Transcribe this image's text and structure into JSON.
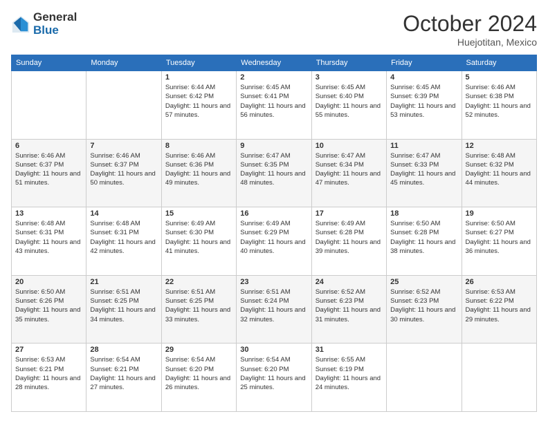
{
  "logo": {
    "general": "General",
    "blue": "Blue"
  },
  "header": {
    "month": "October 2024",
    "location": "Huejotitan, Mexico"
  },
  "weekdays": [
    "Sunday",
    "Monday",
    "Tuesday",
    "Wednesday",
    "Thursday",
    "Friday",
    "Saturday"
  ],
  "weeks": [
    [
      {
        "day": null,
        "info": null
      },
      {
        "day": null,
        "info": null
      },
      {
        "day": "1",
        "sunrise": "6:44 AM",
        "sunset": "6:42 PM",
        "daylight": "11 hours and 57 minutes."
      },
      {
        "day": "2",
        "sunrise": "6:45 AM",
        "sunset": "6:41 PM",
        "daylight": "11 hours and 56 minutes."
      },
      {
        "day": "3",
        "sunrise": "6:45 AM",
        "sunset": "6:40 PM",
        "daylight": "11 hours and 55 minutes."
      },
      {
        "day": "4",
        "sunrise": "6:45 AM",
        "sunset": "6:39 PM",
        "daylight": "11 hours and 53 minutes."
      },
      {
        "day": "5",
        "sunrise": "6:46 AM",
        "sunset": "6:38 PM",
        "daylight": "11 hours and 52 minutes."
      }
    ],
    [
      {
        "day": "6",
        "sunrise": "6:46 AM",
        "sunset": "6:37 PM",
        "daylight": "11 hours and 51 minutes."
      },
      {
        "day": "7",
        "sunrise": "6:46 AM",
        "sunset": "6:37 PM",
        "daylight": "11 hours and 50 minutes."
      },
      {
        "day": "8",
        "sunrise": "6:46 AM",
        "sunset": "6:36 PM",
        "daylight": "11 hours and 49 minutes."
      },
      {
        "day": "9",
        "sunrise": "6:47 AM",
        "sunset": "6:35 PM",
        "daylight": "11 hours and 48 minutes."
      },
      {
        "day": "10",
        "sunrise": "6:47 AM",
        "sunset": "6:34 PM",
        "daylight": "11 hours and 47 minutes."
      },
      {
        "day": "11",
        "sunrise": "6:47 AM",
        "sunset": "6:33 PM",
        "daylight": "11 hours and 45 minutes."
      },
      {
        "day": "12",
        "sunrise": "6:48 AM",
        "sunset": "6:32 PM",
        "daylight": "11 hours and 44 minutes."
      }
    ],
    [
      {
        "day": "13",
        "sunrise": "6:48 AM",
        "sunset": "6:31 PM",
        "daylight": "11 hours and 43 minutes."
      },
      {
        "day": "14",
        "sunrise": "6:48 AM",
        "sunset": "6:31 PM",
        "daylight": "11 hours and 42 minutes."
      },
      {
        "day": "15",
        "sunrise": "6:49 AM",
        "sunset": "6:30 PM",
        "daylight": "11 hours and 41 minutes."
      },
      {
        "day": "16",
        "sunrise": "6:49 AM",
        "sunset": "6:29 PM",
        "daylight": "11 hours and 40 minutes."
      },
      {
        "day": "17",
        "sunrise": "6:49 AM",
        "sunset": "6:28 PM",
        "daylight": "11 hours and 39 minutes."
      },
      {
        "day": "18",
        "sunrise": "6:50 AM",
        "sunset": "6:28 PM",
        "daylight": "11 hours and 38 minutes."
      },
      {
        "day": "19",
        "sunrise": "6:50 AM",
        "sunset": "6:27 PM",
        "daylight": "11 hours and 36 minutes."
      }
    ],
    [
      {
        "day": "20",
        "sunrise": "6:50 AM",
        "sunset": "6:26 PM",
        "daylight": "11 hours and 35 minutes."
      },
      {
        "day": "21",
        "sunrise": "6:51 AM",
        "sunset": "6:25 PM",
        "daylight": "11 hours and 34 minutes."
      },
      {
        "day": "22",
        "sunrise": "6:51 AM",
        "sunset": "6:25 PM",
        "daylight": "11 hours and 33 minutes."
      },
      {
        "day": "23",
        "sunrise": "6:51 AM",
        "sunset": "6:24 PM",
        "daylight": "11 hours and 32 minutes."
      },
      {
        "day": "24",
        "sunrise": "6:52 AM",
        "sunset": "6:23 PM",
        "daylight": "11 hours and 31 minutes."
      },
      {
        "day": "25",
        "sunrise": "6:52 AM",
        "sunset": "6:23 PM",
        "daylight": "11 hours and 30 minutes."
      },
      {
        "day": "26",
        "sunrise": "6:53 AM",
        "sunset": "6:22 PM",
        "daylight": "11 hours and 29 minutes."
      }
    ],
    [
      {
        "day": "27",
        "sunrise": "6:53 AM",
        "sunset": "6:21 PM",
        "daylight": "11 hours and 28 minutes."
      },
      {
        "day": "28",
        "sunrise": "6:54 AM",
        "sunset": "6:21 PM",
        "daylight": "11 hours and 27 minutes."
      },
      {
        "day": "29",
        "sunrise": "6:54 AM",
        "sunset": "6:20 PM",
        "daylight": "11 hours and 26 minutes."
      },
      {
        "day": "30",
        "sunrise": "6:54 AM",
        "sunset": "6:20 PM",
        "daylight": "11 hours and 25 minutes."
      },
      {
        "day": "31",
        "sunrise": "6:55 AM",
        "sunset": "6:19 PM",
        "daylight": "11 hours and 24 minutes."
      },
      {
        "day": null,
        "info": null
      },
      {
        "day": null,
        "info": null
      }
    ]
  ]
}
